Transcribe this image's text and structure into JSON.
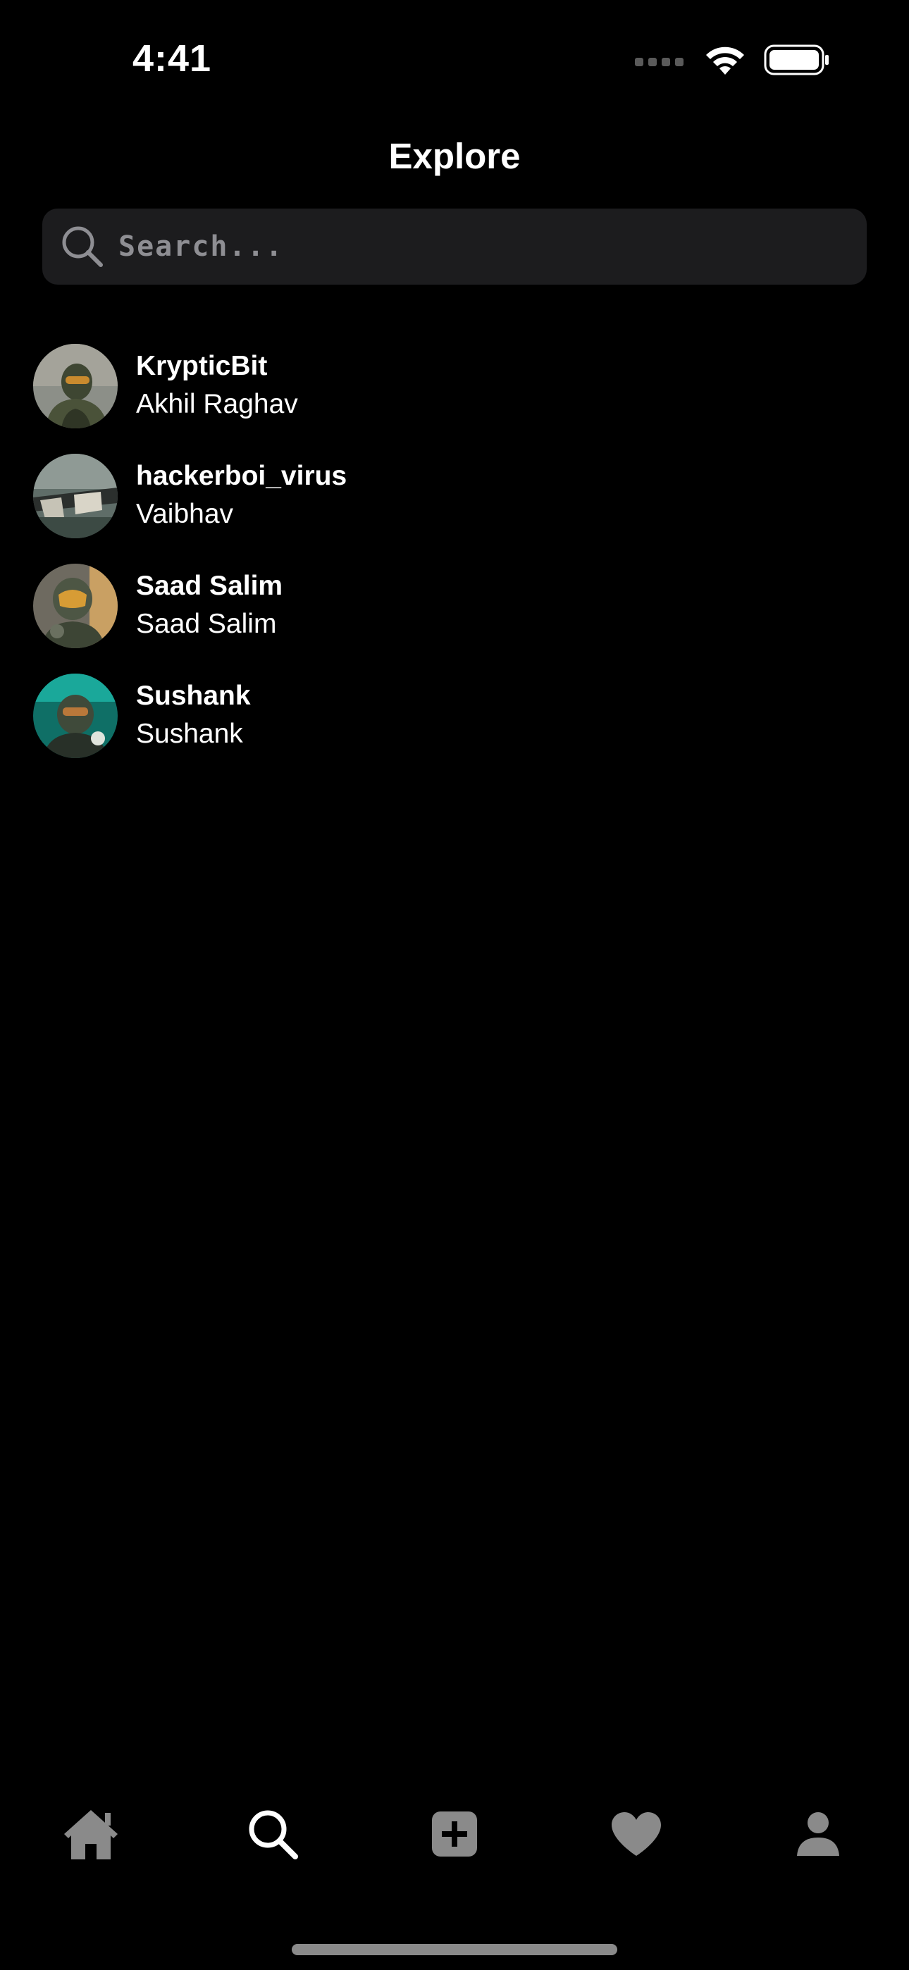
{
  "status_bar": {
    "time": "4:41",
    "icons": [
      "cellular-signal-icon",
      "wifi-icon",
      "battery-icon"
    ]
  },
  "header": {
    "title": "Explore"
  },
  "search": {
    "placeholder": "Search...",
    "value": "",
    "icon": "search-icon"
  },
  "users": [
    {
      "username": "KrypticBit",
      "full_name": "Akhil Raghav"
    },
    {
      "username": "hackerboi_virus",
      "full_name": "Vaibhav"
    },
    {
      "username": "Saad Salim",
      "full_name": "Saad Salim"
    },
    {
      "username": "Sushank",
      "full_name": "Sushank"
    }
  ],
  "tab_bar": {
    "tabs": [
      {
        "name": "home",
        "icon": "home-icon",
        "active": false
      },
      {
        "name": "explore",
        "icon": "search-icon",
        "active": true
      },
      {
        "name": "create",
        "icon": "plus-square-icon",
        "active": false
      },
      {
        "name": "activity",
        "icon": "heart-icon",
        "active": false
      },
      {
        "name": "profile",
        "icon": "person-icon",
        "active": false
      }
    ]
  },
  "colors": {
    "background": "#000000",
    "search_field": "#1c1c1e",
    "text_primary": "#ffffff",
    "placeholder": "#8e8e93",
    "tab_inactive": "#8a8a8a",
    "tab_active": "#ffffff"
  }
}
